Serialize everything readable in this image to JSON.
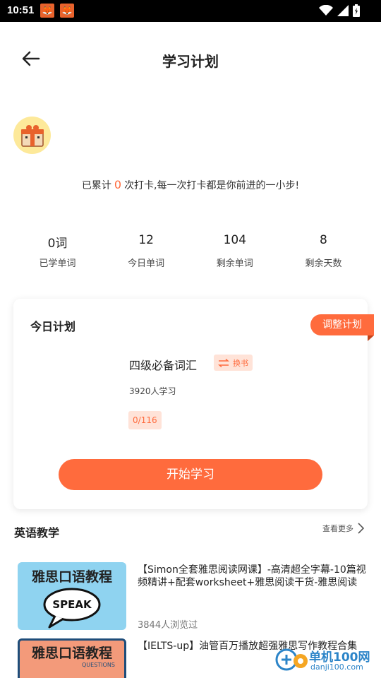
{
  "status_bar": {
    "time": "10:51"
  },
  "header": {
    "title": "学习计划"
  },
  "checkin": {
    "prefix": "已累计",
    "count": "0",
    "suffix": "次打卡,每一次打卡都是你前进的一小步!"
  },
  "stats": [
    {
      "value": "0词",
      "label": "已学单词"
    },
    {
      "value": "12",
      "label": "今日单词"
    },
    {
      "value": "104",
      "label": "剩余单词"
    },
    {
      "value": "8",
      "label": "剩余天数"
    }
  ],
  "plan": {
    "title": "今日计划",
    "adjust_label": "调整计划",
    "book_name": "四级必备词汇",
    "swap_label": "换书",
    "learners": "3920人学习",
    "progress": "0/116",
    "start_label": "开始学习"
  },
  "section": {
    "title": "英语教学",
    "more_label": "查看更多"
  },
  "courses": [
    {
      "thumb_title": "雅思口语教程",
      "thumb_badge": "SPEAK",
      "title": "【Simon全套雅思阅读网课】-高清超全字幕-10篇视频精讲+配套worksheet+雅思阅读干货-雅思阅读轻...",
      "views": "3844人浏览过"
    },
    {
      "thumb_title": "雅思口语教程",
      "thumb_badge": "QUESTIONS",
      "title": "【IELTS-up】油管百万播放超强雅思写作教程合集",
      "views": ""
    }
  ],
  "watermark": {
    "text": "单机100网",
    "sub": "danji100.com"
  },
  "colors": {
    "accent": "#ff6b3d",
    "accent_light": "#ffe3d8",
    "avatar_bg": "#fde99a"
  }
}
